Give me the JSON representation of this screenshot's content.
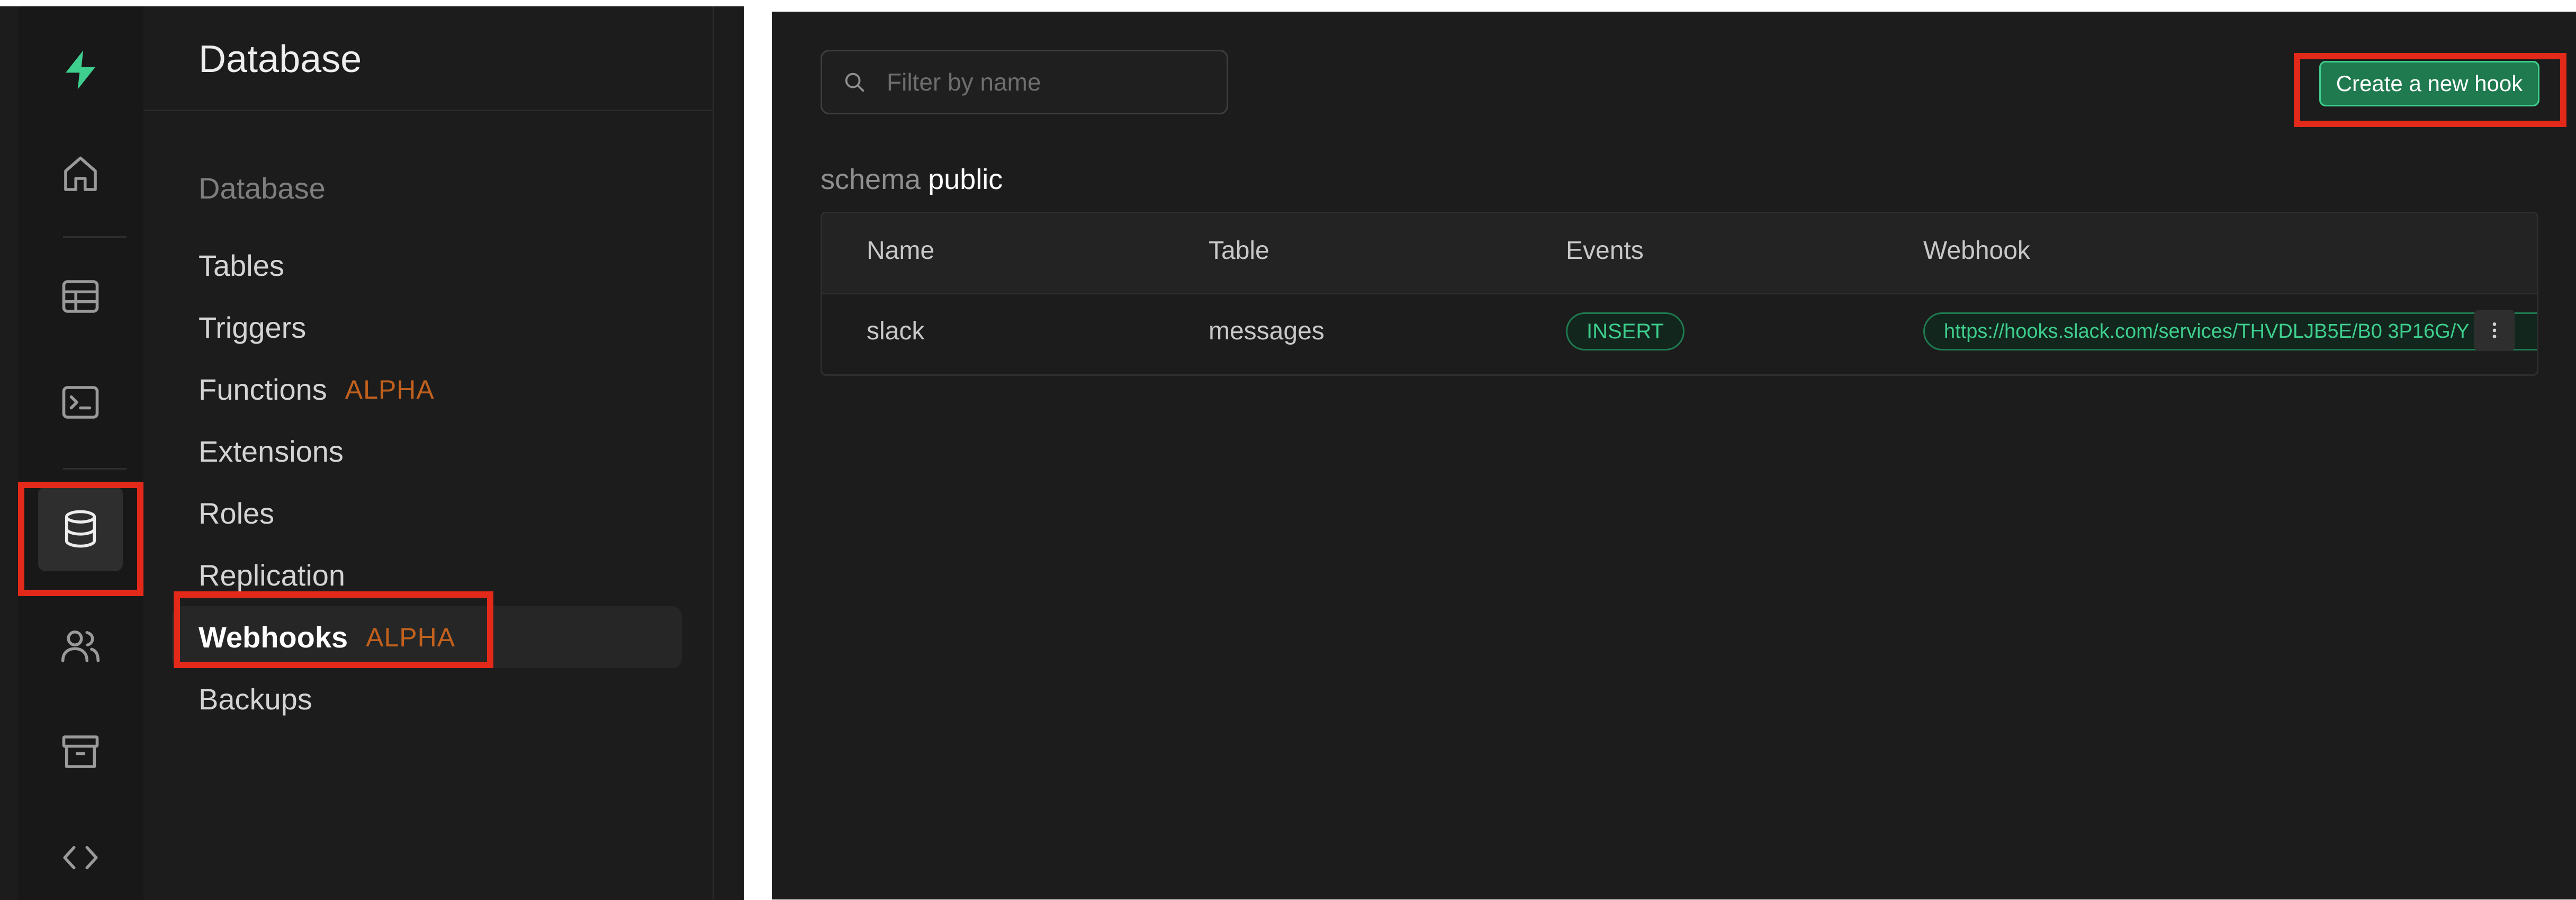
{
  "colors": {
    "brand_green": "#3ecf8e",
    "alpha_badge": "#c2611d",
    "highlight_red": "#e32a1a",
    "button_green": "#1f7a4f"
  },
  "rail": {
    "logo": "supabase-bolt-icon",
    "items": [
      {
        "icon": "home-icon"
      },
      {
        "icon": "table-icon"
      },
      {
        "icon": "terminal-icon"
      },
      {
        "icon": "database-icon",
        "active": true
      },
      {
        "icon": "users-icon"
      },
      {
        "icon": "archive-icon"
      },
      {
        "icon": "code-icon"
      }
    ]
  },
  "sidebar": {
    "title": "Database",
    "section_label": "Database",
    "items": [
      {
        "label": "Tables",
        "badge": ""
      },
      {
        "label": "Triggers",
        "badge": ""
      },
      {
        "label": "Functions",
        "badge": "ALPHA"
      },
      {
        "label": "Extensions",
        "badge": ""
      },
      {
        "label": "Roles",
        "badge": ""
      },
      {
        "label": "Replication",
        "badge": ""
      },
      {
        "label": "Webhooks",
        "badge": "ALPHA",
        "active": true
      },
      {
        "label": "Backups",
        "badge": ""
      }
    ]
  },
  "main": {
    "search": {
      "placeholder": "Filter by name",
      "value": ""
    },
    "create_button_label": "Create a new hook",
    "schema_label": "schema",
    "schema_value": "public",
    "table": {
      "columns": [
        "Name",
        "Table",
        "Events",
        "Webhook"
      ],
      "rows": [
        {
          "name": "slack",
          "table": "messages",
          "event": "INSERT",
          "webhook": "https://hooks.slack.com/services/THVDLJB5E/B0    3P16G/Y"
        }
      ]
    }
  }
}
